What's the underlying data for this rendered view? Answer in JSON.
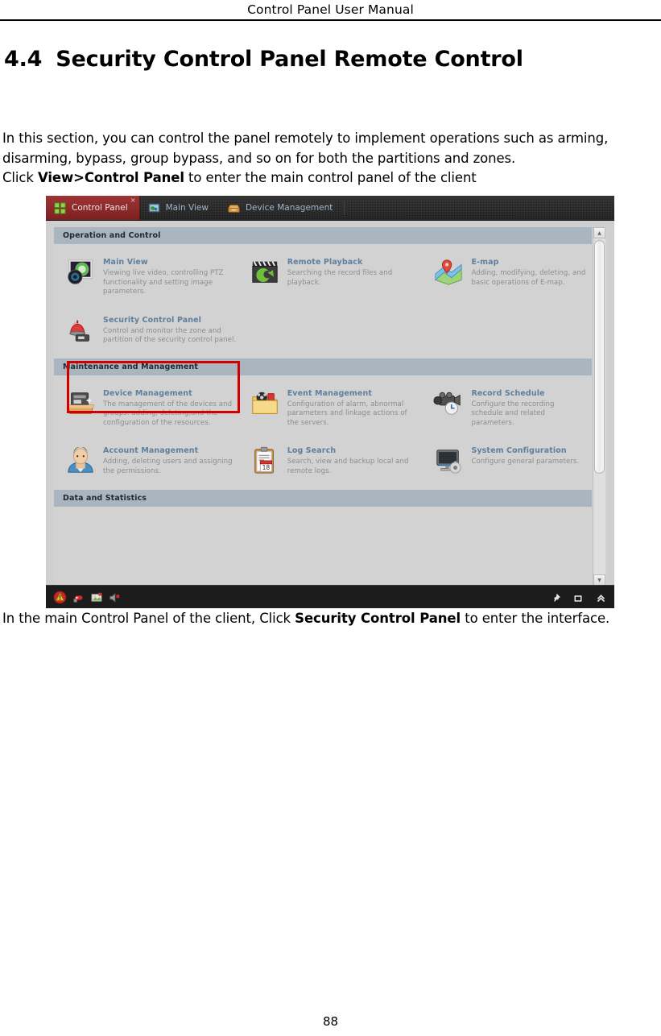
{
  "document": {
    "running_header": "Control Panel User Manual",
    "page_number": "88",
    "chapter_number": "4.4",
    "chapter_title": "Security Control Panel Remote Control",
    "intro_part1": "In this section, you can control the panel remotely to implement operations such as arming, disarming, bypass, group bypass, and so on for both the partitions and zones.",
    "intro_click_prefix": "Click ",
    "intro_click_bold": "View>Control Panel",
    "intro_click_suffix": " to enter the main control panel of the client",
    "caption_prefix": "In the main Control Panel of the client, Click ",
    "caption_bold": "Security Control Panel",
    "caption_suffix": " to enter the interface."
  },
  "screenshot": {
    "tabs": [
      {
        "label": "Control Panel",
        "icon": "grid-icon",
        "active": true,
        "close": "×"
      },
      {
        "label": "Main View",
        "icon": "monitor-icon",
        "active": false
      },
      {
        "label": "Device Management",
        "icon": "device-icon",
        "active": false
      }
    ],
    "sections": [
      {
        "title": "Operation and Control",
        "rows": [
          [
            {
              "name": "Main View",
              "desc": "Viewing live video, controlling PTZ functionality and setting image parameters.",
              "icon": "camera-lens-icon"
            },
            {
              "name": "Remote Playback",
              "desc": "Searching the record files and playback.",
              "icon": "clapboard-icon"
            },
            {
              "name": "E-map",
              "desc": "Adding, modifying, deleting, and basic operations of E-map.",
              "icon": "map-pin-icon"
            }
          ],
          [
            {
              "name": "Security Control Panel",
              "desc": "Control and monitor the zone and partition of the security control panel.",
              "icon": "alarm-siren-icon",
              "highlighted": true
            }
          ]
        ]
      },
      {
        "title": "Maintenance and Management",
        "rows": [
          [
            {
              "name": "Device Management",
              "desc": "The management of the devices and groups: adding, deleting,and the configuration of the resources.",
              "icon": "server-tray-icon"
            },
            {
              "name": "Event Management",
              "desc": "Configuration of alarm, abnormal parameters and linkage actions of the servers.",
              "icon": "media-folder-icon"
            },
            {
              "name": "Record Schedule",
              "desc": "Configure the recording schedule and related parameters.",
              "icon": "camcorder-clock-icon"
            }
          ],
          [
            {
              "name": "Account Management",
              "desc": "Adding, deleting users and assigning the permissions.",
              "icon": "user-avatar-icon"
            },
            {
              "name": "Log Search",
              "desc": "Search, view and backup local and remote logs.",
              "icon": "clipboard-calendar-icon",
              "badge": "18"
            },
            {
              "name": "System Configuration",
              "desc": "Configure general parameters.",
              "icon": "monitor-gear-icon"
            }
          ]
        ]
      },
      {
        "title": "Data and Statistics",
        "rows": []
      }
    ],
    "statusbar": {
      "left_icons": [
        "alarm-warning-icon",
        "alarm-event-icon",
        "picture-alarm-icon",
        "audio-alarm-icon"
      ],
      "right_icons": [
        "pin-icon",
        "maximize-icon",
        "collapse-up-icon"
      ]
    },
    "scrollbar": {
      "up_arrow": "▲",
      "down_arrow": "▼"
    },
    "colors": {
      "active_tab": "#8d2a2a",
      "section_header": "#a9b6bf",
      "module_title": "#5f7f9c",
      "highlight_border": "#d00000",
      "client_background": "#d2d2d2"
    }
  }
}
